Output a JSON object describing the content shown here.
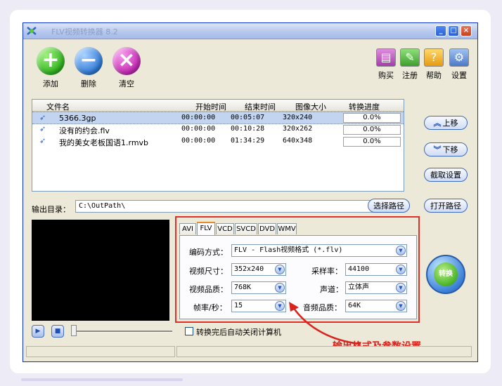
{
  "window": {
    "title": "FLV视频转换器 8.2"
  },
  "toolbar": {
    "add_label": "添加",
    "delete_label": "删除",
    "clear_label": "清空",
    "buy_label": "购买",
    "register_label": "注册",
    "help_label": "帮助",
    "settings_label": "设置"
  },
  "file_list": {
    "columns": [
      "文件名",
      "开始时间",
      "结束时间",
      "图像大小",
      "转换进度"
    ],
    "rows": [
      {
        "name": "5366.3gp",
        "start": "00:00:00",
        "end": "00:05:07",
        "size": "320x240",
        "progress": "0.0%"
      },
      {
        "name": "没有的约会.flv",
        "start": "00:00:00",
        "end": "00:10:28",
        "size": "320x262",
        "progress": "0.0%"
      },
      {
        "name": "我的美女老板国语1.rmvb",
        "start": "00:00:00",
        "end": "01:34:29",
        "size": "640x348",
        "progress": "0.0%"
      }
    ]
  },
  "side_buttons": {
    "move_up": "上移",
    "move_down": "下移",
    "clip_settings": "截取设置"
  },
  "output": {
    "label": "输出目录：",
    "path": "C:\\OutPath\\",
    "choose_path": "选择路径",
    "open_path": "打开路径"
  },
  "format_tabs": [
    "AVI",
    "FLV",
    "VCD",
    "SVCD",
    "DVD",
    "WMV"
  ],
  "format_active_tab": "FLV",
  "params": {
    "codec_label": "编码方式：",
    "codec_value": "FLV - Flash视频格式 (*.flv)",
    "video_size_label": "视频尺寸：",
    "video_size_value": "352x240",
    "sample_rate_label": "采样率：",
    "sample_rate_value": "44100",
    "video_quality_label": "视频品质：",
    "video_quality_value": "768K",
    "channel_label": "声道：",
    "channel_value": "立体声",
    "fps_label": "帧率/秒：",
    "fps_value": "15",
    "audio_quality_label": "音频品质：",
    "audio_quality_value": "64K"
  },
  "convert_button": "转换",
  "shutdown_checkbox": "转换完后自动关闭计算机",
  "annotation": "输出格式及参数设置"
}
